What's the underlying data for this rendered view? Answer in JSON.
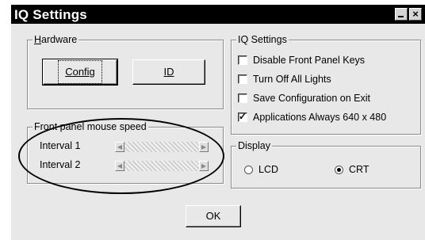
{
  "window": {
    "title": "IQ Settings"
  },
  "hardware": {
    "legend_prefix": "",
    "legend_accel": "H",
    "legend_rest": "ardware",
    "config_label": "Config",
    "id_label": "ID"
  },
  "iq_settings": {
    "legend": "IQ Settings",
    "options": [
      {
        "label": "Disable Front Panel Keys",
        "checked": false
      },
      {
        "label": "Turn Off All Lights",
        "checked": false
      },
      {
        "label": "Save Configuration on Exit",
        "checked": false
      },
      {
        "label": "Applications Always 640 x 480",
        "checked": true
      }
    ]
  },
  "speed": {
    "legend": "Front panel mouse speed",
    "interval1_label": "Interval 1",
    "interval2_label": "Interval 2"
  },
  "display": {
    "legend": "Display",
    "lcd_label": "LCD",
    "crt_label": "CRT",
    "selected": "CRT"
  },
  "footer": {
    "ok_label": "OK"
  }
}
